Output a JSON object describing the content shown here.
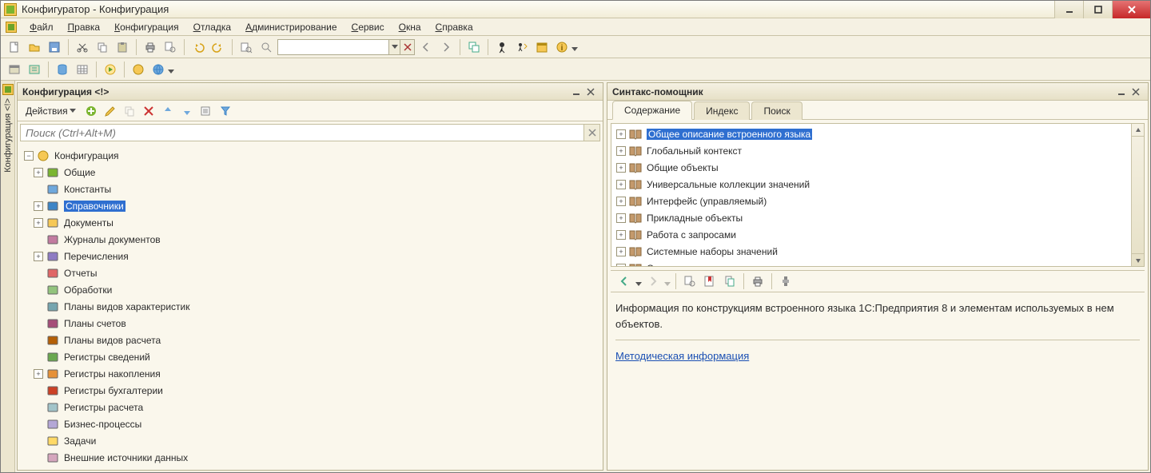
{
  "window": {
    "title": "Конфигуратор - Конфигурация"
  },
  "menu": [
    "Файл",
    "Правка",
    "Конфигурация",
    "Отладка",
    "Администрирование",
    "Сервис",
    "Окна",
    "Справка"
  ],
  "left_strip_label": "Конфигурация <!>",
  "config_panel": {
    "title": "Конфигурация <!>",
    "actions_label": "Действия",
    "search_placeholder": "Поиск (Ctrl+Alt+M)",
    "root": "Конфигурация",
    "nodes": [
      {
        "label": "Общие",
        "expandable": true
      },
      {
        "label": "Константы",
        "expandable": false
      },
      {
        "label": "Справочники",
        "expandable": true,
        "selected": true
      },
      {
        "label": "Документы",
        "expandable": true
      },
      {
        "label": "Журналы документов",
        "expandable": false
      },
      {
        "label": "Перечисления",
        "expandable": true
      },
      {
        "label": "Отчеты",
        "expandable": false
      },
      {
        "label": "Обработки",
        "expandable": false
      },
      {
        "label": "Планы видов характеристик",
        "expandable": false
      },
      {
        "label": "Планы счетов",
        "expandable": false
      },
      {
        "label": "Планы видов расчета",
        "expandable": false
      },
      {
        "label": "Регистры сведений",
        "expandable": false
      },
      {
        "label": "Регистры накопления",
        "expandable": true
      },
      {
        "label": "Регистры бухгалтерии",
        "expandable": false
      },
      {
        "label": "Регистры расчета",
        "expandable": false
      },
      {
        "label": "Бизнес-процессы",
        "expandable": false
      },
      {
        "label": "Задачи",
        "expandable": false
      },
      {
        "label": "Внешние источники данных",
        "expandable": false
      }
    ]
  },
  "syntax_panel": {
    "title": "Синтакс-помощник",
    "tabs": [
      "Содержание",
      "Индекс",
      "Поиск"
    ],
    "active_tab": 0,
    "items": [
      {
        "label": "Общее описание встроенного языка",
        "selected": true
      },
      {
        "label": "Глобальный контекст"
      },
      {
        "label": "Общие объекты"
      },
      {
        "label": "Универсальные коллекции значений"
      },
      {
        "label": "Интерфейс (управляемый)"
      },
      {
        "label": "Прикладные объекты"
      },
      {
        "label": "Работа с запросами"
      },
      {
        "label": "Системные наборы значений"
      },
      {
        "label": "Системные перечисления"
      }
    ],
    "body_text": "Информация по конструкциям встроенного языка 1С:Предприятия 8 и элементам используемых в нем объектов.",
    "link_text": "Методическая информация"
  }
}
